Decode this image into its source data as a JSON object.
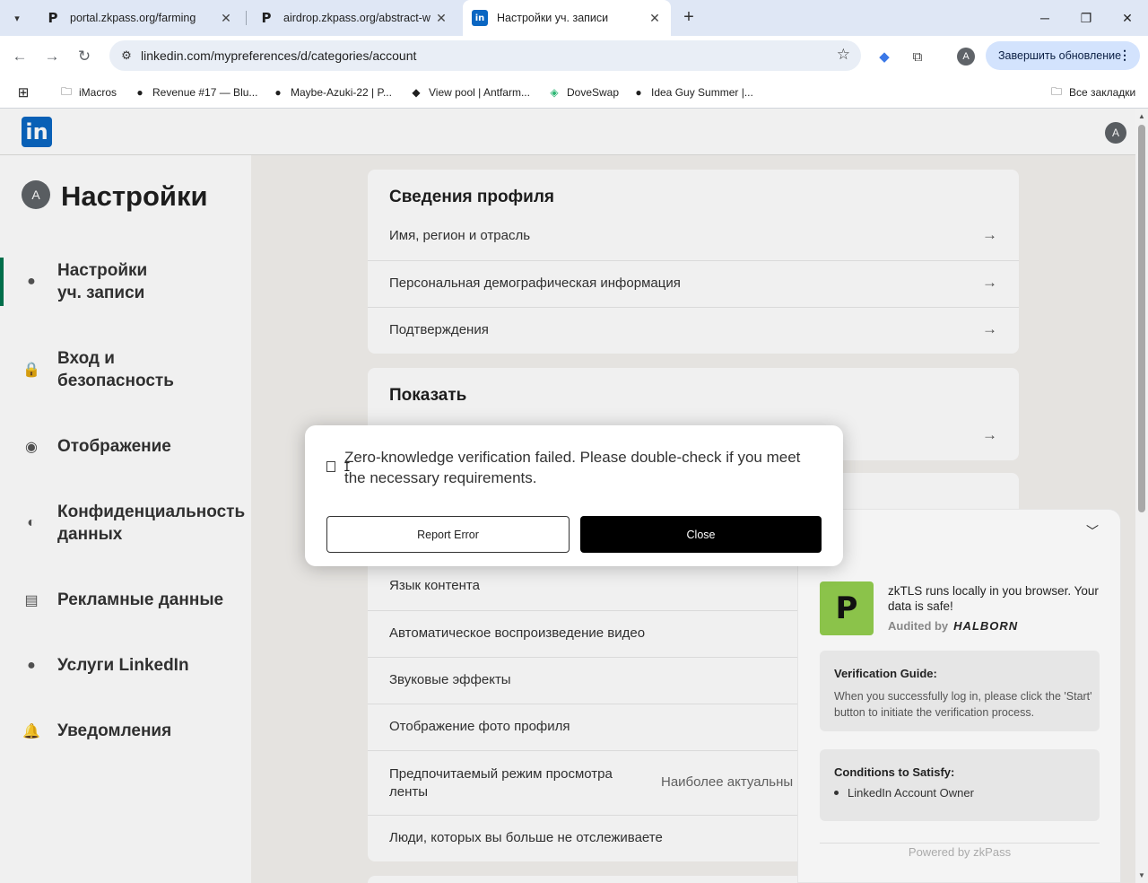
{
  "browser": {
    "tabs": [
      {
        "title": "portal.zkpass.org/farming",
        "favicon": "P"
      },
      {
        "title": "airdrop.zkpass.org/abstract-wal",
        "favicon": "P"
      },
      {
        "title": "Настройки уч. записи",
        "favicon": "in"
      }
    ],
    "url": "linkedin.com/mypreferences/d/categories/account",
    "update_label": "Завершить обновление",
    "profile_initial": "A",
    "bookmarks": [
      {
        "label": "iMacros",
        "icon": "folder-icon"
      },
      {
        "label": "Revenue #17 — Blu...",
        "icon": "mask-icon"
      },
      {
        "label": "Maybe-Azuki-22 | P...",
        "icon": "mask-icon"
      },
      {
        "label": "View pool | Antfarm...",
        "icon": "diamond-icon"
      },
      {
        "label": "DoveSwap",
        "icon": "dove-icon"
      },
      {
        "label": "Idea Guy Summer |...",
        "icon": "mask-icon"
      }
    ],
    "all_bookmarks": "Все закладки"
  },
  "linkedin": {
    "logo": "in",
    "avatar_initial": "A",
    "settings_title": "Настройки",
    "sidebar": [
      {
        "label": "Настройки\nуч. записи",
        "icon": "person-icon"
      },
      {
        "label": "Вход и\nбезопасность",
        "icon": "lock-icon"
      },
      {
        "label": "Отображение",
        "icon": "eye-icon"
      },
      {
        "label": "Конфиденциальность\nданных",
        "icon": "shield-icon"
      },
      {
        "label": "Рекламные данные",
        "icon": "ad-icon"
      },
      {
        "label": "Услуги LinkedIn",
        "icon": "person-icon"
      },
      {
        "label": "Уведомления",
        "icon": "bell-icon"
      }
    ],
    "profile_card": {
      "title": "Сведения профиля",
      "rows": [
        "Имя, регион и отрасль",
        "Персональная демографическая информация",
        "Подтверждения"
      ]
    },
    "display_card": {
      "title": "Показать"
    },
    "pref_rows": [
      "Язык контента",
      "Автоматическое воспроизведение видео",
      "Звуковые эффекты",
      "Отображение фото профиля",
      "Предпочитаемый режим просмотра ленты",
      "Люди, которых вы больше не отслеживаете"
    ],
    "feed_value": "Наиболее актуальны"
  },
  "zkpass": {
    "tagline": "zkTLS runs locally in you browser. Your data is safe!",
    "audited_by": "Audited by",
    "auditor": "HALBORN",
    "guide_title": "Verification Guide:",
    "guide_text": "When you successfully log in, please click the 'Start' button to initiate the verification process.",
    "conditions_title": "Conditions to Satisfy:",
    "condition_item": "LinkedIn Account Owner",
    "footer": "Powered by zkPass"
  },
  "modal": {
    "message": "Zero-knowledge verification failed. Please double-check if you meet the necessary requirements.",
    "report_label": "Report Error",
    "close_label": "Close"
  }
}
